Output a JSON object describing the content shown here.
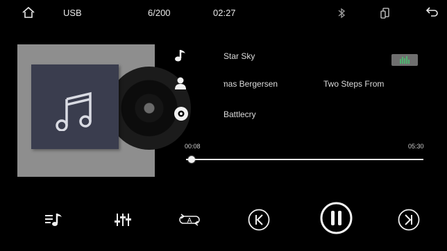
{
  "status_bar": {
    "source_label": "USB",
    "track_index": "6/200",
    "clock": "02:27",
    "home_icon": "home-icon",
    "bluetooth_icon": "bluetooth-icon",
    "phone_icon": "phone-link-icon",
    "back_icon": "back-arrow-icon"
  },
  "now_playing": {
    "title": "Star Sky",
    "artists": "Thomas Bergersen",
    "band": "Two Steps From Hell",
    "album": "Battlecry",
    "title_icon": "music-note-icon",
    "artist_icon": "person-icon",
    "album_icon": "disc-icon"
  },
  "progress": {
    "elapsed": "00:08",
    "duration": "05:30",
    "fraction": 0.024
  },
  "controls": {
    "playlist_icon": "playlist-icon",
    "equalizer_icon": "equalizer-sliders-icon",
    "repeat_icon": "repeat-all-icon",
    "repeat_badge": "A",
    "previous_icon": "previous-track-icon",
    "pause_icon": "pause-icon",
    "next_icon": "next-track-icon"
  },
  "colors": {
    "background": "#000000",
    "accent": "#4fb36f",
    "album_bg": "#8e8e8e",
    "sleeve": "#3a3d4e"
  }
}
